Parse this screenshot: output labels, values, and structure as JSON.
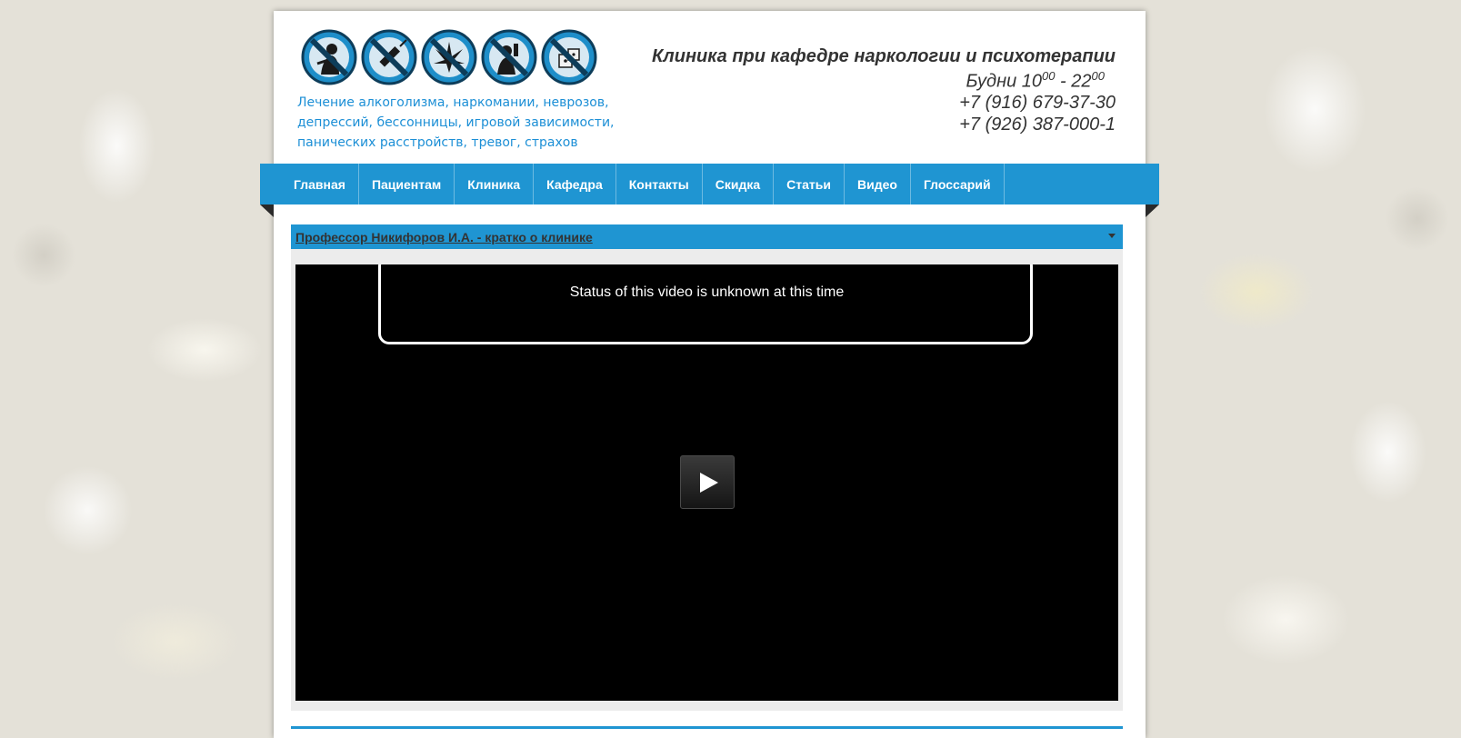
{
  "header": {
    "icons": [
      "no-smoking-icon",
      "no-syringe-icon",
      "no-cannabis-icon",
      "no-alcohol-icon",
      "no-gambling-icon"
    ],
    "tagline_lines": [
      "Лечение алкоголизма, наркомании, неврозов,",
      "депрессий, бессонницы, игровой зависимости,",
      "панических расстройств, тревог, страхов"
    ],
    "clinic_title": "Клиника при кафедре наркологии и психотерапии",
    "hours": {
      "label": "Будни 10",
      "open_sup": "00",
      "dash": " - 22",
      "close_sup": "00"
    },
    "phones": [
      "+7 (916) 679-37-30",
      "+7 (926) 387-000-1"
    ]
  },
  "nav": {
    "items": [
      "Главная",
      "Пациентам",
      "Клиника",
      "Кафедра",
      "Контакты",
      "Скидка",
      "Статьи",
      "Видео",
      "Глоссарий"
    ]
  },
  "panel": {
    "title": "Профессор Никифоров И.А. - кратко о клинике"
  },
  "video": {
    "status_text": "Status of this video is unknown at this time"
  },
  "colors": {
    "brand_blue": "#1f95d2",
    "tagline_blue": "#1c8fd6",
    "text_dark": "#333333"
  }
}
